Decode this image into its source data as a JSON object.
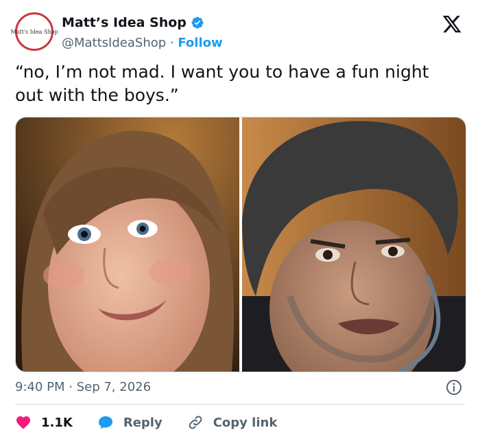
{
  "account": {
    "avatar_text": "Matt's Idea Shop",
    "display_name": "Matt’s Idea Shop",
    "handle": "@MattsIdeaShop",
    "separator": " · ",
    "follow_label": "Follow"
  },
  "tweet": {
    "text": "“no, I’m not mad. I want you to have a fun night out with the boys.”",
    "timestamp": "9:40 PM · Sep 7, 2026"
  },
  "media": {
    "images": [
      {
        "description": "woman-smiling-photo"
      },
      {
        "description": "man-intense-look-photo"
      }
    ]
  },
  "actions": {
    "like_count": "1.1K",
    "reply_label": "Reply",
    "copy_link_label": "Copy link"
  },
  "colors": {
    "link": "#1d9bf0",
    "like": "#f91880",
    "reply": "#1d9bf0",
    "text": "#0f1419",
    "secondary": "#536471",
    "avatar_ring": "#c8373b"
  },
  "icons": {
    "verified": "verified-badge-icon",
    "logo": "x-logo-icon",
    "info": "info-icon",
    "like": "heart-icon",
    "reply": "speech-bubble-icon",
    "copy": "link-icon"
  }
}
